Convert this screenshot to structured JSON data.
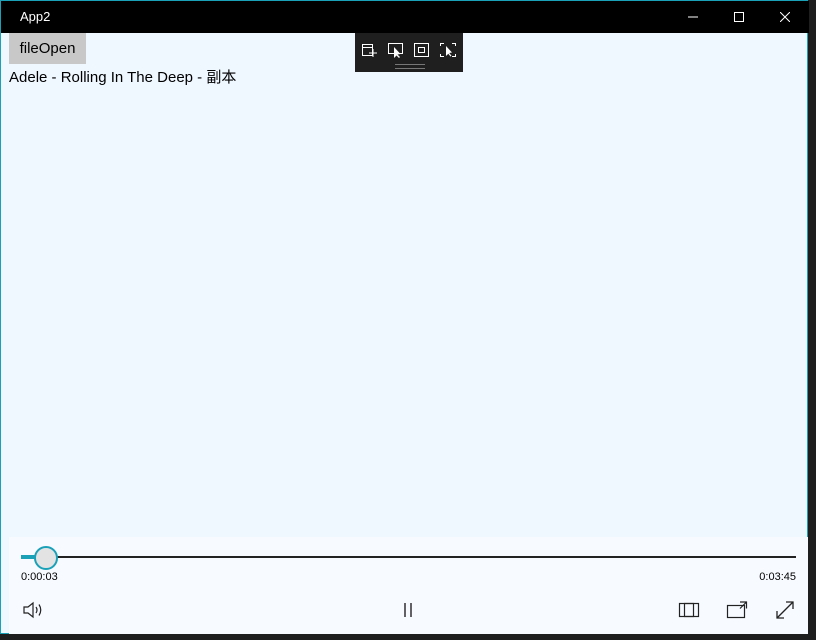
{
  "window": {
    "title": "App2",
    "accent": "#1aa1b8",
    "background": "#eff7ff"
  },
  "main": {
    "file_open_label": "fileOpen",
    "song_title": "Adele - Rolling In The Deep - 副本"
  },
  "debug_toolbar": {
    "icons": [
      "visual-tree-icon",
      "select-element-icon",
      "display-layout-adorners-icon",
      "track-focus-icon"
    ]
  },
  "player": {
    "current_time": "0:00:03",
    "total_time": "0:03:45",
    "progress_fraction": 0.013,
    "buttons": [
      "volume-icon",
      "pause-icon",
      "aspect-ratio-icon",
      "cast-icon",
      "fullscreen-icon"
    ]
  }
}
